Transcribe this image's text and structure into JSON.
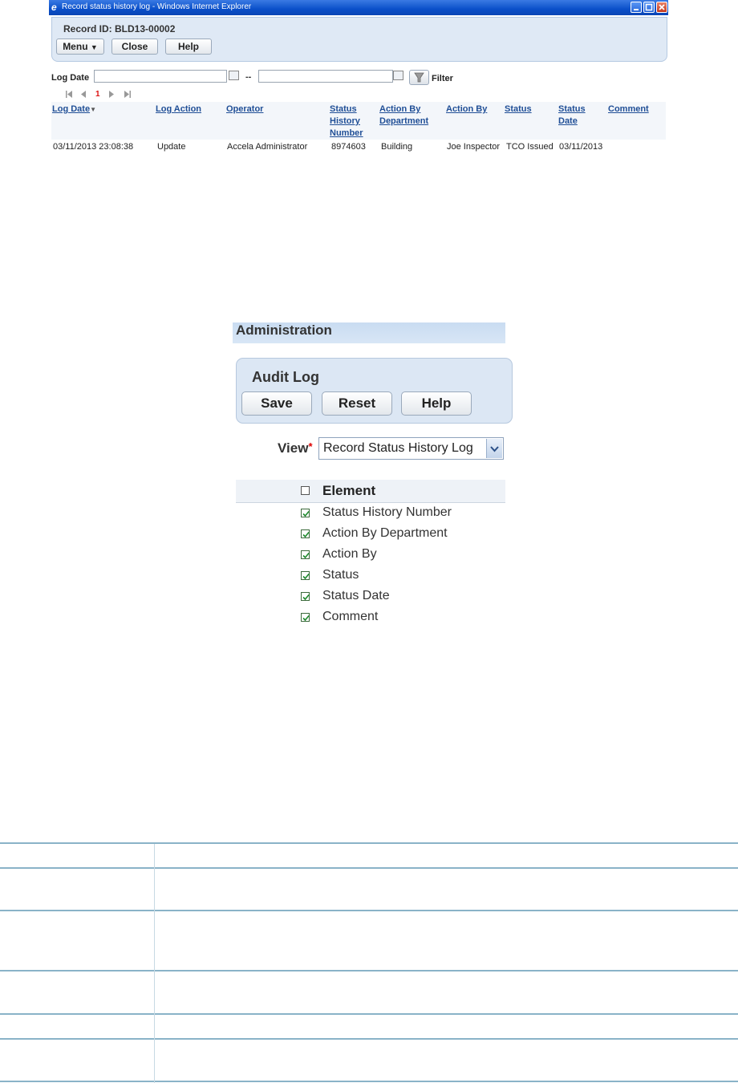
{
  "window": {
    "title": "Record status history log - Windows Internet Explorer",
    "record_id": "Record ID: BLD13-00002",
    "buttons": {
      "menu": "Menu",
      "close": "Close",
      "help": "Help"
    }
  },
  "filter": {
    "log_date_label": "Log Date",
    "from_value": "",
    "to_value": "",
    "separator": "--",
    "filter_label": "Filter"
  },
  "pager": {
    "current_page": "1"
  },
  "grid": {
    "columns": [
      "Log Date",
      "Log Action",
      "Operator",
      "Status History Number",
      "Action By Department",
      "Action By",
      "Status",
      "Status Date",
      "Comment"
    ],
    "rows": [
      [
        "03/11/2013 23:08:38",
        "Update",
        "Accela Administrator",
        "8974603",
        "Building",
        "Joe Inspector",
        "TCO Issued",
        "03/11/2013",
        ""
      ]
    ]
  },
  "admin": {
    "title": "Administration",
    "panel_title": "Audit Log",
    "buttons": {
      "save": "Save",
      "reset": "Reset",
      "help": "Help"
    },
    "view_label": "View",
    "view_required": "*",
    "view_value": "Record Status History Log",
    "element_header": "Element",
    "elements": [
      {
        "label": "Status History Number",
        "checked": true
      },
      {
        "label": "Action By Department",
        "checked": true
      },
      {
        "label": "Action By",
        "checked": true
      },
      {
        "label": "Status",
        "checked": true
      },
      {
        "label": "Status Date",
        "checked": true
      },
      {
        "label": "Comment",
        "checked": true
      }
    ]
  },
  "colors": {
    "titlebar": "#0a4fc9",
    "panel_bg": "#dce7f4",
    "link": "#1f4e96",
    "table_line": "#8ab3c8"
  }
}
